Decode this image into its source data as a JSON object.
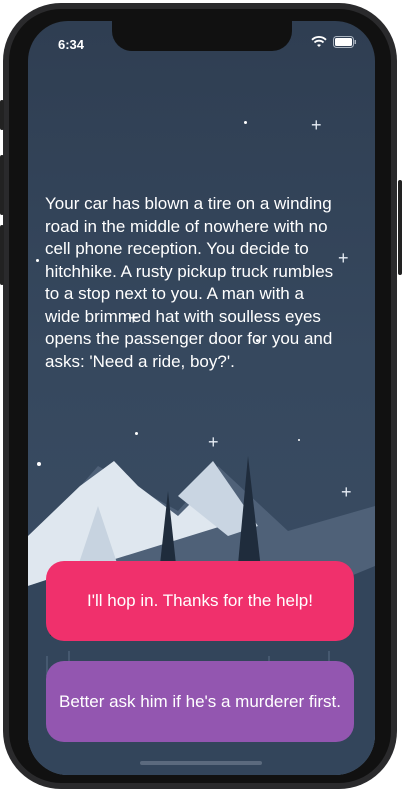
{
  "status_bar": {
    "time": "6:34",
    "wifi_icon": "wifi-icon",
    "battery_icon": "battery-icon"
  },
  "story": {
    "text": "Your car has blown a tire on a winding road in the middle of nowhere with no cell phone reception. You decide to hitchhike. A rusty pickup truck rumbles to a stop next to you. A man with a wide brimmed hat with soulless eyes opens the passenger door for you and asks: 'Need a ride, boy?'."
  },
  "choices": [
    {
      "label": "I'll hop in. Thanks for the help!",
      "color": "#f0306c"
    },
    {
      "label": "Better ask him if he's a murderer first.",
      "color": "#9356b0"
    }
  ],
  "colors": {
    "sky_top": "#2f3e52",
    "sky_bottom": "#3b4e65",
    "mountain": "#e6ecf2",
    "tree": "#1f2c3c"
  }
}
